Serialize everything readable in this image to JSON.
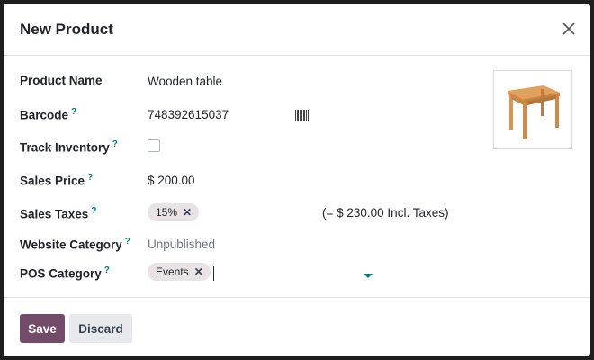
{
  "dialog": {
    "title": "New Product",
    "close_icon": "close-icon"
  },
  "form": {
    "product_name": {
      "label": "Product Name",
      "value": "Wooden table"
    },
    "barcode": {
      "label": "Barcode",
      "help": "?",
      "value": "748392615037",
      "icon": "barcode-icon"
    },
    "track_inventory": {
      "label": "Track Inventory",
      "help": "?",
      "checked": false
    },
    "sales_price": {
      "label": "Sales Price",
      "help": "?",
      "value": "$ 200.00"
    },
    "sales_taxes": {
      "label": "Sales Taxes",
      "help": "?",
      "tag": "15%",
      "tag_remove": "✕",
      "incl_text": "(= $ 230.00 Incl. Taxes)"
    },
    "website_category": {
      "label": "Website Category",
      "help": "?",
      "value": "Unpublished"
    },
    "pos_category": {
      "label": "POS Category",
      "help": "?",
      "tag": "Events",
      "tag_remove": "✕",
      "dropdown_icon": "caret-down-icon"
    }
  },
  "image": {
    "icon": "product-image-wooden-table"
  },
  "footer": {
    "save_label": "Save",
    "discard_label": "Discard"
  },
  "colors": {
    "brand": "#714b67",
    "help": "#017e84",
    "tag_bg": "#e9e3e6"
  }
}
